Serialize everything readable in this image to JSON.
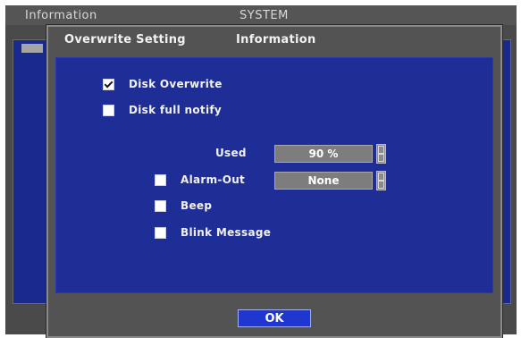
{
  "background": {
    "title_left": "Information",
    "title_center": "SYSTEM"
  },
  "dialog": {
    "tabs": [
      {
        "label": "Overwrite Setting"
      },
      {
        "label": "Information"
      }
    ],
    "options": {
      "disk_overwrite": {
        "label": "Disk Overwrite",
        "checked": true
      },
      "disk_full_notify": {
        "label": "Disk full notify",
        "checked": false
      }
    },
    "notify": {
      "used_label": "Used",
      "used_value": "90 %",
      "alarm_out": {
        "label": "Alarm-Out",
        "checked": false,
        "value": "None"
      },
      "beep": {
        "label": "Beep",
        "checked": false
      },
      "blink_message": {
        "label": "Blink Message",
        "checked": false
      }
    },
    "ok_label": "OK"
  },
  "colors": {
    "panel_blue": "#1e2e96",
    "dialog_gray": "#535353",
    "button_blue": "#1f37d0"
  }
}
